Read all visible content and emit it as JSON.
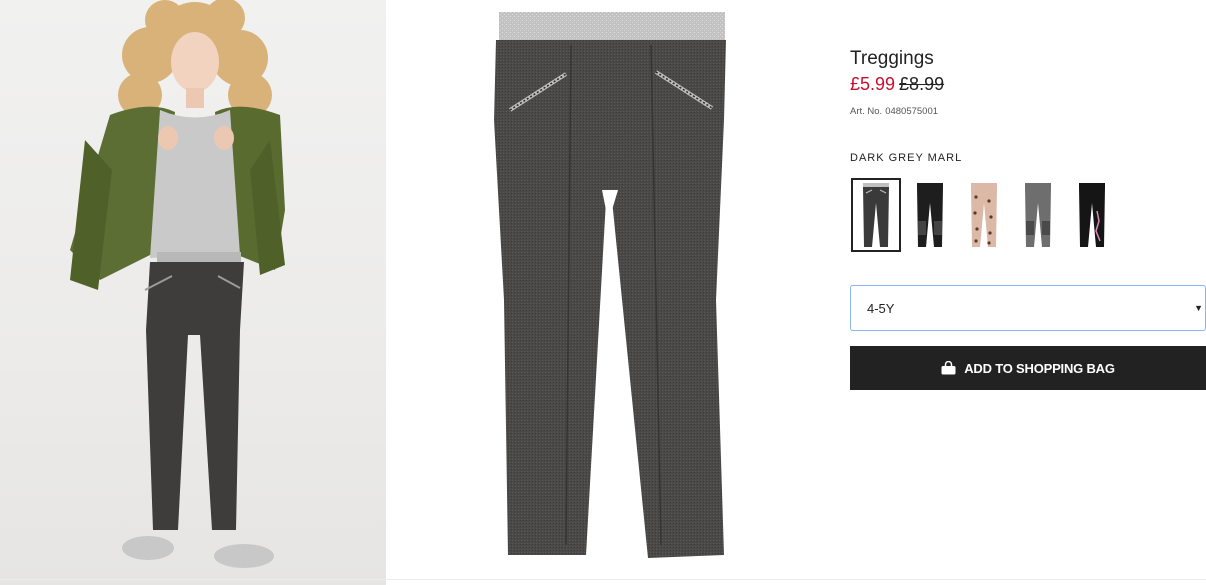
{
  "product": {
    "title": "Treggings",
    "price_sale": "£5.99",
    "price_original": "£8.99",
    "art_label": "Art. No.",
    "art_number": "0480575001"
  },
  "color": {
    "selected_name": "DARK GREY MARL",
    "swatches": [
      {
        "name": "dark-grey-marl",
        "selected": true,
        "fill": "#3a3a3a",
        "accent": "#bfbfbf"
      },
      {
        "name": "black-knee-patch",
        "selected": false,
        "fill": "#1e1e1e",
        "accent": "#444444"
      },
      {
        "name": "leopard",
        "selected": false,
        "fill": "#dcb9a6",
        "accent": "#5a3a2a"
      },
      {
        "name": "grey-knee-patch",
        "selected": false,
        "fill": "#6e6e6e",
        "accent": "#4a4a4a"
      },
      {
        "name": "black-print",
        "selected": false,
        "fill": "#151515",
        "accent": "#d98ab8"
      }
    ]
  },
  "size": {
    "selected": "4-5Y"
  },
  "actions": {
    "add_to_bag_label": "ADD TO SHOPPING BAG"
  },
  "colors": {
    "sale": "#c8102e",
    "button_bg": "#222222",
    "select_border": "#8ab4f8"
  }
}
